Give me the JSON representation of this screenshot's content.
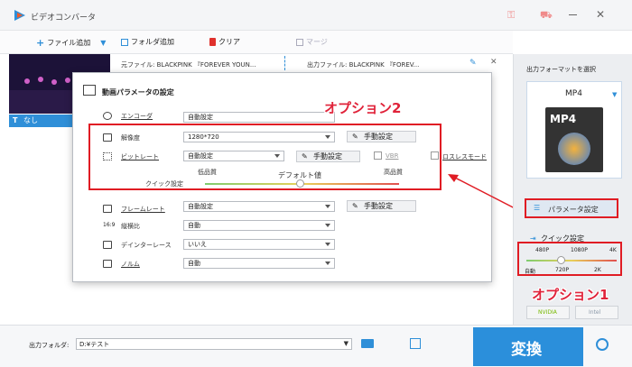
{
  "window": {
    "title": "ビデオコンバータ"
  },
  "toolbar": {
    "add_file": "ファイル追加",
    "add_folder": "フォルダ追加",
    "clear": "クリア",
    "merge": "マージ"
  },
  "file": {
    "source": "元ファイル: BLACKPINK 『FOREVER YOUN...",
    "output": "出力ファイル: BLACKPINK 『FOREV...",
    "subtitle": "なし"
  },
  "dialog": {
    "title": "動画パラメータの設定",
    "encoder_label": "エンコーダ",
    "encoder_value": "自動設定",
    "resolution_label": "解像度",
    "resolution_value": "1280*720",
    "bitrate_label": "ビットレート",
    "bitrate_value": "自動設定",
    "vbr": "VBR",
    "lossless": "ロスレスモード",
    "quick_label": "クイック設定",
    "low_quality": "低品質",
    "default_value": "デフォルト値",
    "high_quality": "高品質",
    "framerate_label": "フレームレート",
    "framerate_value": "自動設定",
    "aspect_label": "縦横比",
    "aspect_value": "自動",
    "deinterlace_label": "デインターレース",
    "deinterlace_value": "いいえ",
    "norm_label": "ノルム",
    "norm_value": "自動",
    "manual": "手動設定"
  },
  "annotations": {
    "option1": "オプション1",
    "option2": "オプション2"
  },
  "right": {
    "format_title": "出力フォーマットを選択",
    "format": "MP4",
    "format_badge": "MP4",
    "param_button": "パラメータ設定",
    "quick_title": "クイック設定",
    "q_top": [
      "480P",
      "1080P",
      "4K"
    ],
    "q_bottom": [
      "自動",
      "720P",
      "2K"
    ],
    "nvidia": "NVIDIA",
    "intel": "Intel"
  },
  "bottom": {
    "folder_label": "出力フォルダ:",
    "folder_value": "D:¥テスト",
    "convert": "変換"
  },
  "colors": {
    "accent": "#2f8fd8",
    "red": "#e01c24",
    "convert": "#2b8fdb"
  }
}
